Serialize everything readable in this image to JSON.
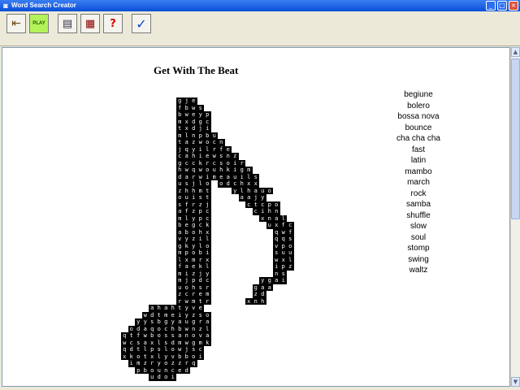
{
  "window": {
    "title": "Word Search Creator"
  },
  "toolbar": {
    "buttons": [
      {
        "name": "exit-door-button",
        "icon": "exit-door-icon",
        "glyph": "⇤"
      },
      {
        "name": "play-button",
        "icon": "play-icon",
        "glyph": "PLAY"
      },
      {
        "name": "view-puzzle-button",
        "icon": "document-icon",
        "glyph": "▤"
      },
      {
        "name": "view-grid-button",
        "icon": "grid-icon",
        "glyph": "▦"
      },
      {
        "name": "help-button",
        "icon": "question-icon",
        "glyph": "?"
      },
      {
        "name": "done-button",
        "icon": "checkmark-icon",
        "glyph": "✓"
      }
    ]
  },
  "puzzle": {
    "title": "Get With The Beat",
    "words": [
      "begiune",
      "bolero",
      "bossa nova",
      "bounce",
      "cha cha cha",
      "fast",
      "latin",
      "mambo",
      "march",
      "rock",
      "samba",
      "shuffle",
      "slow",
      "soul",
      "stomp",
      "swing",
      "waltz"
    ],
    "rows": [
      {
        "line": 0,
        "start": 8,
        "text": "gje"
      },
      {
        "line": 1,
        "start": 8,
        "text": "fbws"
      },
      {
        "line": 2,
        "start": 8,
        "text": "bweyp"
      },
      {
        "line": 3,
        "start": 8,
        "text": "mxdgc"
      },
      {
        "line": 4,
        "start": 8,
        "text": "txdji"
      },
      {
        "line": 5,
        "start": 8,
        "text": "mlnpbu"
      },
      {
        "line": 6,
        "start": 8,
        "text": "tazwocn"
      },
      {
        "line": 7,
        "start": 8,
        "text": "jqyilrfe"
      },
      {
        "line": 8,
        "start": 8,
        "text": "cahiewsnz"
      },
      {
        "line": 9,
        "start": 8,
        "text": "gcckrcsoir"
      },
      {
        "line": 10,
        "start": 8,
        "text": "hwqwouhkigm"
      },
      {
        "line": 11,
        "start": 8,
        "text": "darwimeauils"
      },
      {
        "line": 12,
        "start": 8,
        "text": "usjlo odchxx"
      },
      {
        "line": 13,
        "start": 8,
        "text": "zhhmt   ylhauo"
      },
      {
        "line": 14,
        "start": 8,
        "text": "ouist    aajy"
      },
      {
        "line": 15,
        "start": 8,
        "text": "sfrzj     ctcpo"
      },
      {
        "line": 16,
        "start": 8,
        "text": "afzpc      cihn"
      },
      {
        "line": 17,
        "start": 8,
        "text": "mlypc       xnal"
      },
      {
        "line": 18,
        "start": 8,
        "text": "begck        uxfc"
      },
      {
        "line": 19,
        "start": 8,
        "text": "abohx         qwf"
      },
      {
        "line": 20,
        "start": 8,
        "text": "vyzil         qqs"
      },
      {
        "line": 21,
        "start": 8,
        "text": "gkylo         vpo"
      },
      {
        "line": 22,
        "start": 8,
        "text": "mpobi         suu"
      },
      {
        "line": 23,
        "start": 8,
        "text": "lxmrx         wxl"
      },
      {
        "line": 24,
        "start": 8,
        "text": "faekl         ipz"
      },
      {
        "line": 25,
        "start": 8,
        "text": "mizjy         ns"
      },
      {
        "line": 26,
        "start": 8,
        "text": "mjpdc       ygai"
      },
      {
        "line": 27,
        "start": 8,
        "text": "uohsr      gaa"
      },
      {
        "line": 28,
        "start": 8,
        "text": "zcrem      zd"
      },
      {
        "line": 29,
        "start": 8,
        "text": "rwmtr     xnh"
      },
      {
        "line": 30,
        "start": 4,
        "text": "ahahtyve"
      },
      {
        "line": 31,
        "start": 3,
        "text": "wdtmeiyzso"
      },
      {
        "line": 32,
        "start": 2,
        "text": "yysbgyaugra"
      },
      {
        "line": 33,
        "start": 1,
        "text": "odaqochbwnzl"
      },
      {
        "line": 34,
        "start": 0,
        "text": "qtfwbossanova"
      },
      {
        "line": 35,
        "start": 0,
        "text": "wcsaxlsdmwgmk"
      },
      {
        "line": 36,
        "start": 0,
        "text": "qdtlpslowjsc"
      },
      {
        "line": 37,
        "start": 0,
        "text": "xkotxlyvbboi"
      },
      {
        "line": 38,
        "start": 1,
        "text": "imzryozzrq"
      },
      {
        "line": 39,
        "start": 2,
        "text": "pbounced"
      },
      {
        "line": 40,
        "start": 4,
        "text": "udoi"
      }
    ]
  }
}
